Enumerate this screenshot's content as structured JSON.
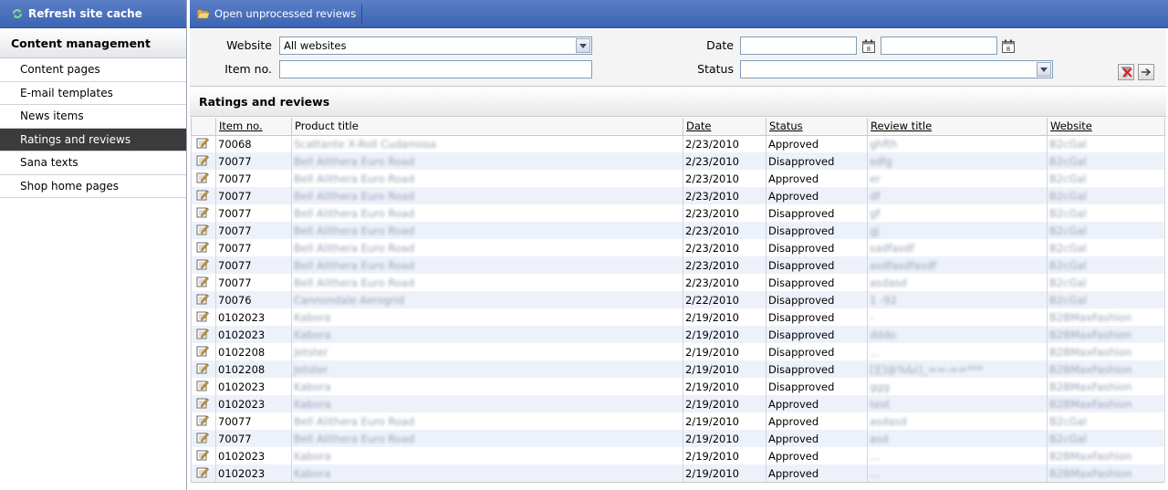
{
  "sidebar": {
    "refresh_label": "Refresh site cache",
    "section_title": "Content management",
    "items": [
      {
        "label": "Content pages",
        "active": false
      },
      {
        "label": "E-mail templates",
        "active": false
      },
      {
        "label": "News items",
        "active": false
      },
      {
        "label": "Ratings and reviews",
        "active": true
      },
      {
        "label": "Sana texts",
        "active": false
      },
      {
        "label": "Shop home pages",
        "active": false
      }
    ]
  },
  "toolbar": {
    "open_unprocessed_label": "Open unprocessed reviews"
  },
  "filters": {
    "website_label": "Website",
    "website_value": "All websites",
    "item_no_label": "Item no.",
    "item_no_value": "",
    "date_label": "Date",
    "date_from": "",
    "date_to": "",
    "status_label": "Status",
    "status_value": ""
  },
  "grid": {
    "title": "Ratings and reviews",
    "columns": [
      "Item no.",
      "Product title",
      "Date",
      "Status",
      "Review title",
      "Website"
    ],
    "rows": [
      {
        "item": "70068",
        "product": "Scattante X-Roll Cudamosa",
        "date": "2/23/2010",
        "status": "Approved",
        "review": "ghfth",
        "website": "B2cGal"
      },
      {
        "item": "70077",
        "product": "Bell Alithera Euro Road",
        "date": "2/23/2010",
        "status": "Disapproved",
        "review": "sdfg",
        "website": "B2cGal"
      },
      {
        "item": "70077",
        "product": "Bell Alithera Euro Road",
        "date": "2/23/2010",
        "status": "Approved",
        "review": "er",
        "website": "B2cGal"
      },
      {
        "item": "70077",
        "product": "Bell Alithera Euro Road",
        "date": "2/23/2010",
        "status": "Approved",
        "review": "df",
        "website": "B2cGal"
      },
      {
        "item": "70077",
        "product": "Bell Alithera Euro Road",
        "date": "2/23/2010",
        "status": "Disapproved",
        "review": "gf",
        "website": "B2cGal"
      },
      {
        "item": "70077",
        "product": "Bell Alithera Euro Road",
        "date": "2/23/2010",
        "status": "Disapproved",
        "review": "gj",
        "website": "B2cGal"
      },
      {
        "item": "70077",
        "product": "Bell Alithera Euro Road",
        "date": "2/23/2010",
        "status": "Disapproved",
        "review": "sadfasdf",
        "website": "B2cGal"
      },
      {
        "item": "70077",
        "product": "Bell Alithera Euro Road",
        "date": "2/23/2010",
        "status": "Disapproved",
        "review": "asdfasdfasdf",
        "website": "B2cGal"
      },
      {
        "item": "70077",
        "product": "Bell Alithera Euro Road",
        "date": "2/23/2010",
        "status": "Disapproved",
        "review": "asdasd",
        "website": "B2cGal"
      },
      {
        "item": "70076",
        "product": "Cannondale Aerogrid",
        "date": "2/22/2010",
        "status": "Disapproved",
        "review": "1 -92",
        "website": "B2cGal"
      },
      {
        "item": "0102023",
        "product": "Kabora",
        "date": "2/19/2010",
        "status": "Disapproved",
        "review": "-",
        "website": "B2BMaxFashion"
      },
      {
        "item": "0102023",
        "product": "Kabora",
        "date": "2/19/2010",
        "status": "Disapproved",
        "review": "dddo",
        "website": "B2BMaxFashion"
      },
      {
        "item": "0102208",
        "product": "Jetster",
        "date": "2/19/2010",
        "status": "Disapproved",
        "review": "...",
        "website": "B2BMaxFashion"
      },
      {
        "item": "0102208",
        "product": "Jetster",
        "date": "2/19/2010",
        "status": "Disapproved",
        "review": "[][]@%&()_==-==***",
        "website": "B2BMaxFashion"
      },
      {
        "item": "0102023",
        "product": "Kabora",
        "date": "2/19/2010",
        "status": "Disapproved",
        "review": "ggg",
        "website": "B2BMaxFashion"
      },
      {
        "item": "0102023",
        "product": "Kabora",
        "date": "2/19/2010",
        "status": "Approved",
        "review": "test",
        "website": "B2BMaxFashion"
      },
      {
        "item": "70077",
        "product": "Bell Alithera Euro Road",
        "date": "2/19/2010",
        "status": "Approved",
        "review": "asdasd",
        "website": "B2cGal"
      },
      {
        "item": "70077",
        "product": "Bell Alithera Euro Road",
        "date": "2/19/2010",
        "status": "Approved",
        "review": "asd",
        "website": "B2cGal"
      },
      {
        "item": "0102023",
        "product": "Kabora",
        "date": "2/19/2010",
        "status": "Approved",
        "review": "...",
        "website": "B2BMaxFashion"
      },
      {
        "item": "0102023",
        "product": "Kabora",
        "date": "2/19/2010",
        "status": "Approved",
        "review": "...",
        "website": "B2BMaxFashion"
      }
    ]
  },
  "colors": {
    "header_blue": "#3d64b4",
    "active_nav": "#3b3b3b",
    "alt_row": "#edf1fa"
  },
  "icons": {
    "refresh": "refresh-icon",
    "folder": "folder-open-icon",
    "calendar": "calendar-icon",
    "dropdown": "chevron-down-icon",
    "clear": "clear-filter-icon",
    "go": "arrow-right-icon",
    "edit": "edit-icon"
  }
}
